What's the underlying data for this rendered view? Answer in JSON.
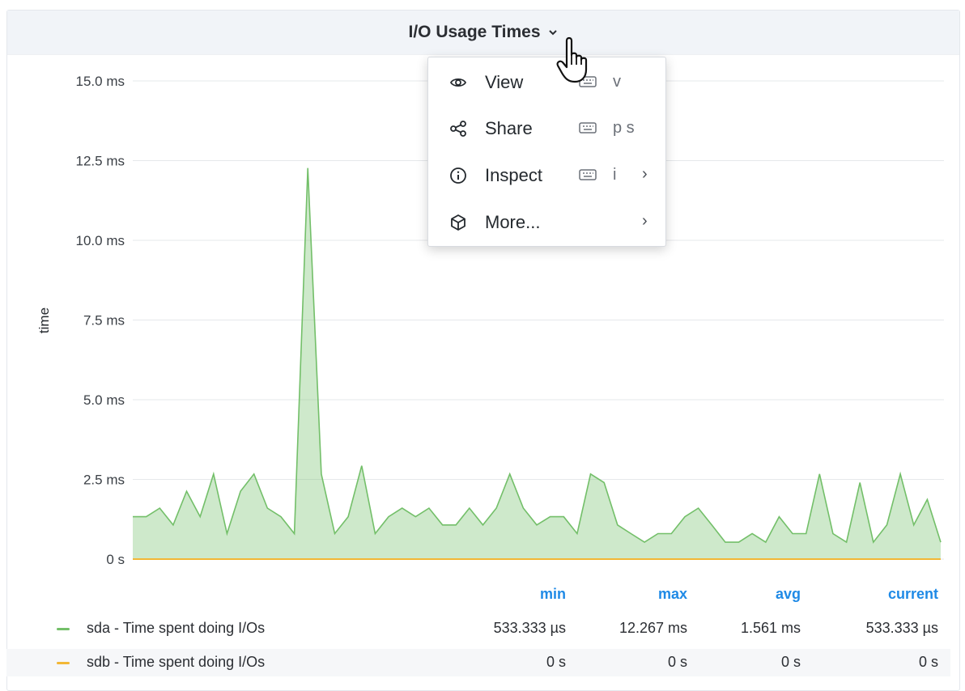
{
  "panel": {
    "title": "I/O Usage Times"
  },
  "menu": {
    "items": [
      {
        "label": "View",
        "icon": "eye-icon",
        "shortcut": "v",
        "submenu": false
      },
      {
        "label": "Share",
        "icon": "share-icon",
        "shortcut": "p s",
        "submenu": false
      },
      {
        "label": "Inspect",
        "icon": "info-icon",
        "shortcut": "i",
        "submenu": true
      },
      {
        "label": "More...",
        "icon": "cube-icon",
        "shortcut": "",
        "submenu": true
      }
    ],
    "submenu_glyph": "›"
  },
  "chart_data": {
    "type": "area",
    "ylabel": "time",
    "y_ticks": [
      "0 s",
      "2.5 ms",
      "5.0 ms",
      "7.5 ms",
      "10.0 ms",
      "12.5 ms",
      "15.0 ms"
    ],
    "ylim": [
      0,
      15
    ],
    "y_unit": "ms",
    "grid": true,
    "series": [
      {
        "name": "sda - Time spent doing I/Os",
        "color": "#73bf69",
        "values": [
          1.33,
          1.33,
          1.6,
          1.07,
          2.13,
          1.33,
          2.67,
          0.8,
          2.13,
          2.67,
          1.6,
          1.33,
          0.8,
          12.27,
          2.67,
          0.8,
          1.33,
          2.93,
          0.8,
          1.33,
          1.6,
          1.33,
          1.6,
          1.07,
          1.07,
          1.6,
          1.07,
          1.6,
          2.67,
          1.6,
          1.07,
          1.33,
          1.33,
          0.8,
          2.67,
          2.4,
          1.07,
          0.8,
          0.53,
          0.8,
          0.8,
          1.33,
          1.6,
          1.07,
          0.53,
          0.53,
          0.8,
          0.53,
          1.33,
          0.8,
          0.8,
          2.67,
          0.8,
          0.53,
          2.4,
          0.53,
          1.07,
          2.67,
          1.07,
          1.87,
          0.53
        ]
      },
      {
        "name": "sdb - Time spent doing I/Os",
        "color": "#f2b736",
        "values": [
          0,
          0,
          0,
          0,
          0,
          0,
          0,
          0,
          0,
          0,
          0,
          0,
          0,
          0,
          0,
          0,
          0,
          0,
          0,
          0,
          0,
          0,
          0,
          0,
          0,
          0,
          0,
          0,
          0,
          0,
          0,
          0,
          0,
          0,
          0,
          0,
          0,
          0,
          0,
          0,
          0,
          0,
          0,
          0,
          0,
          0,
          0,
          0,
          0,
          0,
          0,
          0,
          0,
          0,
          0,
          0,
          0,
          0,
          0,
          0,
          0
        ]
      }
    ]
  },
  "legend": {
    "headers": {
      "min": "min",
      "max": "max",
      "avg": "avg",
      "current": "current"
    },
    "rows": [
      {
        "name": "sda - Time spent doing I/Os",
        "color": "#73bf69",
        "min": "533.333 µs",
        "max": "12.267 ms",
        "avg": "1.561 ms",
        "current": "533.333 µs"
      },
      {
        "name": "sdb - Time spent doing I/Os",
        "color": "#f2b736",
        "min": "0 s",
        "max": "0 s",
        "avg": "0 s",
        "current": "0 s"
      }
    ]
  }
}
